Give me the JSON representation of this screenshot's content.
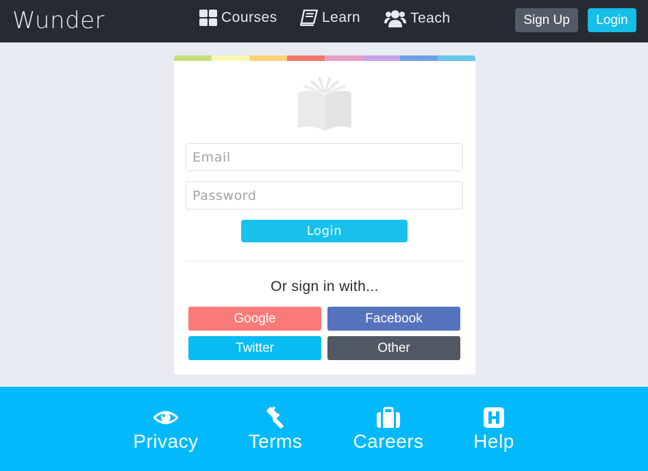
{
  "brand": "Wunder",
  "nav": {
    "courses": "Courses",
    "learn": "Learn",
    "teach": "Teach"
  },
  "header_buttons": {
    "signup": "Sign Up",
    "login": "Login"
  },
  "stripe_colors": [
    "#c4dd78",
    "#f9f8b3",
    "#fdd377",
    "#f4786b",
    "#e6a0c3",
    "#c8a2e4",
    "#6f9fe6",
    "#67c6ea"
  ],
  "form": {
    "email_placeholder": "Email",
    "password_placeholder": "Password",
    "login_label": "Login",
    "alt_signin": "Or sign in with..."
  },
  "social": {
    "google": "Google",
    "facebook": "Facebook",
    "twitter": "Twitter",
    "other": "Other"
  },
  "footer": {
    "privacy": "Privacy",
    "terms": "Terms",
    "careers": "Careers",
    "help": "Help"
  },
  "icons": {
    "courses": "grid-icon",
    "learn": "book-icon",
    "teach": "users-icon",
    "logo": "open-book-icon",
    "privacy": "eye-icon",
    "terms": "gavel-icon",
    "careers": "briefcase-icon",
    "help": "hospital-icon"
  }
}
